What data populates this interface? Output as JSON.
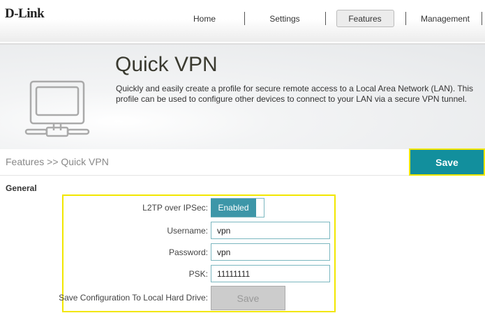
{
  "brand": "D-Link",
  "nav": {
    "items": [
      {
        "label": "Home"
      },
      {
        "label": "Settings"
      },
      {
        "label": "Features"
      },
      {
        "label": "Management"
      }
    ],
    "active": "Features"
  },
  "banner": {
    "title": "Quick VPN",
    "description": "Quickly and easily create a profile for secure remote access to a Local Area Network (LAN). This profile can be used to configure other devices to connect to your LAN via a secure VPN tunnel.",
    "icon": "network-computer-icon"
  },
  "breadcrumb": "Features >> Quick VPN",
  "save_label": "Save",
  "section": "General",
  "form": {
    "l2tp_label": "L2TP over IPSec:",
    "l2tp_value": "Enabled",
    "username_label": "Username:",
    "username": "vpn",
    "password_label": "Password:",
    "password": "vpn",
    "psk_label": "PSK:",
    "psk": "11111111",
    "saveconf_label": "Save Configuration To Local Hard Drive:",
    "saveconf_button": "Save"
  },
  "colors": {
    "accent": "#128f9d",
    "highlight": "#f2e600"
  }
}
